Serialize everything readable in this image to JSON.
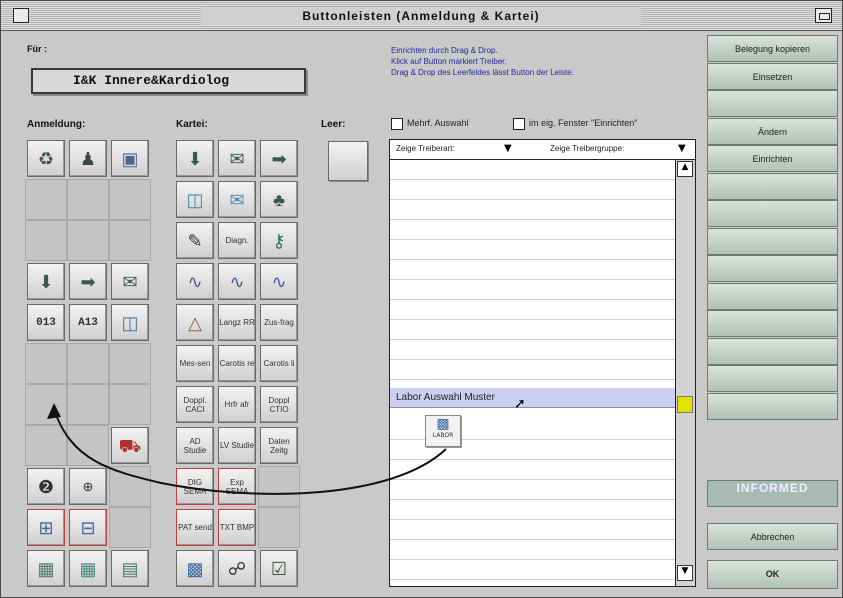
{
  "window": {
    "title": "Buttonleisten (Anmeldung & Kartei)"
  },
  "fuer": {
    "label": "Für :",
    "value": "I&K  Innere&Kardiolog"
  },
  "info": {
    "lines": [
      "Einrichten durch Drag & Drop.",
      "Klick auf Button markiert Treiber.",
      "Drag & Drop des Leerfeldes lässt Button der Leiste."
    ]
  },
  "sections": {
    "anmeldung": "Anmeldung:",
    "kartei": "Kartei:",
    "leer": "Leer:"
  },
  "options": {
    "mehrf": "Mehrf. Auswahl",
    "fenster": "im eig. Fenster \"Einrichten\""
  },
  "list": {
    "col1": "Zeige Treiberart:",
    "col2": "Zeige Treibergruppe:",
    "selected": "Labor Auswahl Muster",
    "drag_label": "LABOR"
  },
  "kartei_labels": {
    "diagn": "Diagn.",
    "lange_rr": "Langz RR",
    "zus_frag": "Zus-frag",
    "mes_sen": "Mes-sen",
    "carotis_re": "Carotis re",
    "carotis_li": "Carotis li",
    "doppl_caci": "Doppl. CACI",
    "hrfr_afr": "Hrfr afr",
    "doppl_ctio": "Doppl CTIO",
    "ad_studie": "AD Studie",
    "lv_studie": "LV Studie",
    "daten_zeitg": "Daten Zeitg",
    "dig_sema": "DIG SEMA",
    "exp_sema": "Exp SEMA",
    "pat_send": "PAT send",
    "txt_bmp": "TXT BMP",
    "ecg": "ECG"
  },
  "anmeldung_labels": {
    "code1": "013",
    "code2": "A13"
  },
  "right_buttons": [
    "Belegung kopieren",
    "Einsetzen",
    "",
    "Ändern",
    "Einrichten",
    "",
    "",
    "",
    "",
    "",
    "",
    "",
    "",
    "",
    "INFORMED",
    "Abbrechen",
    "OK"
  ],
  "colors": {
    "accent_yellow": "#e6e200",
    "selection": "#ccd0f0",
    "sidebar": "#b7c6bc",
    "informed": "#a8bbb2"
  }
}
